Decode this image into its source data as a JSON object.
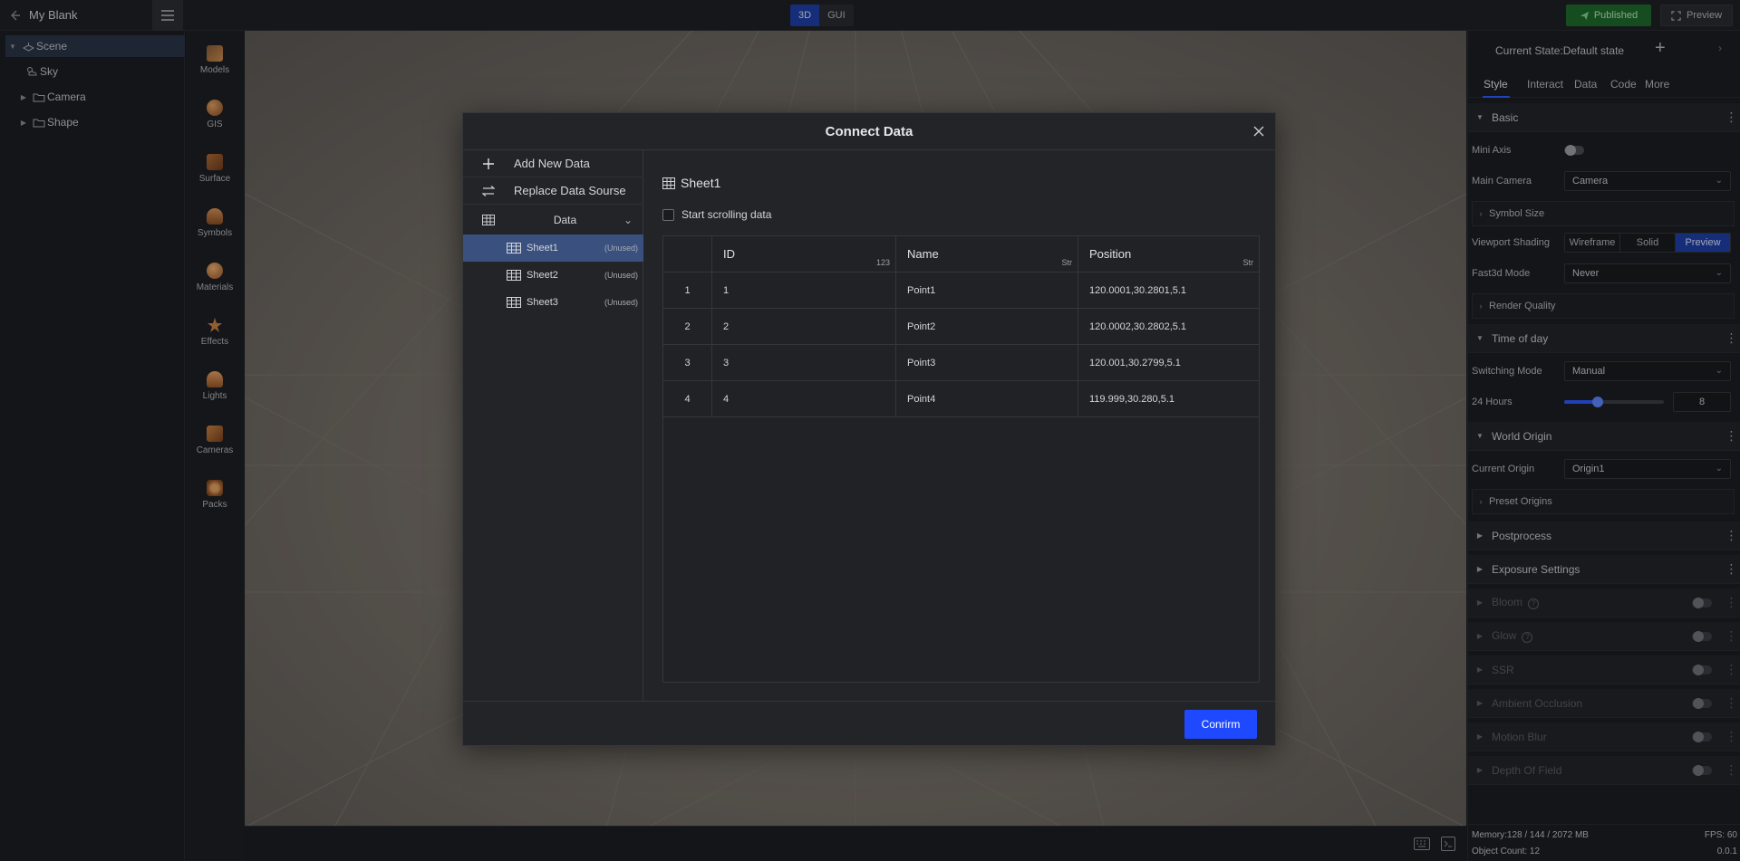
{
  "topbar": {
    "project_name": "My Blank",
    "modes": [
      "3D",
      "GUI"
    ],
    "active_mode": "3D",
    "published_label": "Published",
    "preview_label": "Preview"
  },
  "scene_tree": {
    "items": [
      {
        "label": "Scene",
        "selected": true,
        "icon": "scene-icon"
      },
      {
        "label": "Sky",
        "icon": "sky-icon"
      },
      {
        "label": "Camera",
        "icon": "folder-icon"
      },
      {
        "label": "Shape",
        "icon": "folder-icon"
      }
    ]
  },
  "library": {
    "items": [
      {
        "label": "Models",
        "icon": "models-icon"
      },
      {
        "label": "GIS",
        "icon": "gis-icon"
      },
      {
        "label": "Surface",
        "icon": "surface-icon"
      },
      {
        "label": "Symbols",
        "icon": "symbols-icon"
      },
      {
        "label": "Materials",
        "icon": "materials-icon"
      },
      {
        "label": "Effects",
        "icon": "effects-icon"
      },
      {
        "label": "Lights",
        "icon": "lights-icon"
      },
      {
        "label": "Cameras",
        "icon": "cameras-icon"
      },
      {
        "label": "Packs",
        "icon": "packs-icon"
      }
    ]
  },
  "right_panel": {
    "current_state": "Current State:Default state",
    "tabs": [
      "Style",
      "Interact",
      "Data",
      "Code",
      "More"
    ],
    "active_tab": "Style",
    "basic": {
      "title": "Basic",
      "mini_axis_label": "Mini Axis",
      "main_camera_label": "Main Camera",
      "main_camera_value": "Camera",
      "symbol_size_label": "Symbol Size",
      "viewport_shading_label": "Viewport Shading",
      "shading_options": [
        "Wireframe",
        "Solid",
        "Preview"
      ],
      "shading_active": "Preview",
      "fast3d_label": "Fast3d Mode",
      "fast3d_value": "Never",
      "render_quality_label": "Render Quality"
    },
    "time_of_day": {
      "title": "Time of day",
      "switching_mode_label": "Switching Mode",
      "switching_mode_value": "Manual",
      "hours_label": "24 Hours",
      "hours_value": "8",
      "hours_fraction": 0.333
    },
    "world_origin": {
      "title": "World Origin",
      "current_origin_label": "Current Origin",
      "current_origin_value": "Origin1",
      "preset_origins_label": "Preset Origins"
    },
    "sections": {
      "postprocess": "Postprocess",
      "exposure": "Exposure Settings",
      "bloom": "Bloom",
      "glow": "Glow",
      "ssr": "SSR",
      "ambient_occlusion": "Ambient Occlusion",
      "motion_blur": "Motion Blur",
      "depth_of_field": "Depth Of Field"
    },
    "status": {
      "memory": "Memory:128 / 144 / 2072 MB",
      "fps": "FPS: 60",
      "object_count": "Object Count: 12",
      "version": "0.0.1"
    }
  },
  "modal": {
    "title": "Connect Data",
    "add_new_label": "Add New Data",
    "replace_label": "Replace Data Sourse",
    "group_label": "Data",
    "sheets": [
      {
        "name": "Sheet1",
        "status": "(Unused)",
        "selected": true
      },
      {
        "name": "Sheet2",
        "status": "(Unused)"
      },
      {
        "name": "Sheet3",
        "status": "(Unused)"
      }
    ],
    "sheet_title": "Sheet1",
    "scroll_checkbox_label": "Start scrolling data",
    "table": {
      "columns": [
        {
          "name": "ID",
          "type": "123"
        },
        {
          "name": "Name",
          "type": "Str"
        },
        {
          "name": "Position",
          "type": "Str"
        }
      ],
      "rows": [
        {
          "index": "1",
          "id": "1",
          "name": "Point1",
          "position": "120.0001,30.2801,5.1"
        },
        {
          "index": "2",
          "id": "2",
          "name": "Point2",
          "position": "120.0002,30.2802,5.1"
        },
        {
          "index": "3",
          "id": "3",
          "name": "Point3",
          "position": "120.001,30.2799,5.1"
        },
        {
          "index": "4",
          "id": "4",
          "name": "Point4",
          "position": "119.999,30.280,5.1"
        }
      ]
    },
    "confirm_label": "Conrirm"
  }
}
